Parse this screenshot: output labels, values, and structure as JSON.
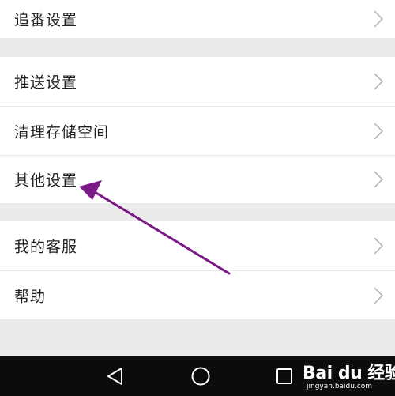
{
  "settings": {
    "items": [
      {
        "label": "追番设置"
      },
      {
        "label": "推送设置"
      },
      {
        "label": "清理存储空间"
      },
      {
        "label": "其他设置"
      },
      {
        "label": "我的客服"
      },
      {
        "label": "帮助"
      }
    ]
  },
  "navbar": {
    "buttons": [
      {
        "icon": "back-triangle-icon"
      },
      {
        "icon": "home-circle-icon"
      },
      {
        "icon": "recents-square-icon"
      }
    ]
  },
  "watermark": {
    "brand": "Bai du 经验",
    "url": "jingyan.baidu.com"
  },
  "annotation": {
    "arrow_color": "#7b1a86",
    "points_to": "其他设置"
  }
}
